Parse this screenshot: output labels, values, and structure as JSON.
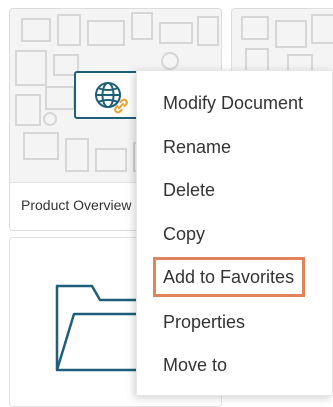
{
  "cards": {
    "product_overview": {
      "title": "Product Overview"
    }
  },
  "context_menu": {
    "items": [
      {
        "label": "Modify Document"
      },
      {
        "label": "Rename"
      },
      {
        "label": "Delete"
      },
      {
        "label": "Copy"
      },
      {
        "label": "Add to Favorites"
      },
      {
        "label": "Properties"
      },
      {
        "label": "Move to"
      }
    ],
    "highlighted_item": "Add to Favorites"
  },
  "colors": {
    "badge_border": "#1f5f7a",
    "highlight_border": "#e0845b",
    "link_icon": "#e8a33a",
    "folder_icon": "#1f5f7a"
  },
  "icons": {
    "document_type": "globe-icon",
    "link_badge": "link-icon",
    "folder": "folder-icon"
  }
}
